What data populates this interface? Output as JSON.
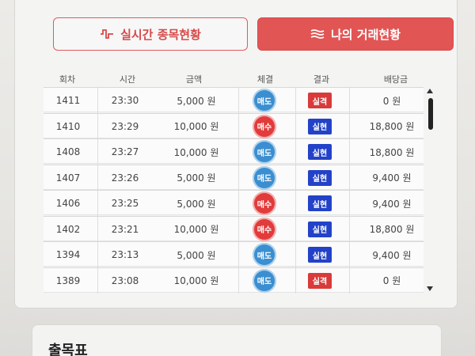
{
  "tabs": [
    {
      "label": "실시간 종목현황",
      "icon": "pulse-icon",
      "active": false
    },
    {
      "label": "나의 거래현황",
      "icon": "stack-icon",
      "active": true
    }
  ],
  "table": {
    "headers": [
      "회차",
      "시간",
      "금액",
      "체결",
      "결과",
      "배당금"
    ],
    "rows": [
      {
        "round": "1411",
        "time": "23:30",
        "amount": "5,000 원",
        "trade": "매도",
        "trade_type": "sell",
        "result": "실격",
        "result_type": "fail",
        "payout": "0 원"
      },
      {
        "round": "1410",
        "time": "23:29",
        "amount": "10,000 원",
        "trade": "매수",
        "trade_type": "buy",
        "result": "실현",
        "result_type": "win",
        "payout": "18,800 원"
      },
      {
        "round": "1408",
        "time": "23:27",
        "amount": "10,000 원",
        "trade": "매도",
        "trade_type": "sell",
        "result": "실현",
        "result_type": "win",
        "payout": "18,800 원"
      },
      {
        "round": "1407",
        "time": "23:26",
        "amount": "5,000 원",
        "trade": "매도",
        "trade_type": "sell",
        "result": "실현",
        "result_type": "win",
        "payout": "9,400 원"
      },
      {
        "round": "1406",
        "time": "23:25",
        "amount": "5,000 원",
        "trade": "매수",
        "trade_type": "buy",
        "result": "실현",
        "result_type": "win",
        "payout": "9,400 원"
      },
      {
        "round": "1402",
        "time": "23:21",
        "amount": "10,000 원",
        "trade": "매수",
        "trade_type": "buy",
        "result": "실현",
        "result_type": "win",
        "payout": "18,800 원"
      },
      {
        "round": "1394",
        "time": "23:13",
        "amount": "5,000 원",
        "trade": "매도",
        "trade_type": "sell",
        "result": "실현",
        "result_type": "win",
        "payout": "9,400 원"
      },
      {
        "round": "1389",
        "time": "23:08",
        "amount": "10,000 원",
        "trade": "매도",
        "trade_type": "sell",
        "result": "실격",
        "result_type": "fail",
        "payout": "0 원"
      }
    ]
  },
  "colors": {
    "accent": "#e25555",
    "sell": "#3b8fd0",
    "buy": "#e23b3b",
    "win": "#2342c8",
    "fail": "#d93a3a"
  },
  "bottom": {
    "title": "출목표"
  }
}
